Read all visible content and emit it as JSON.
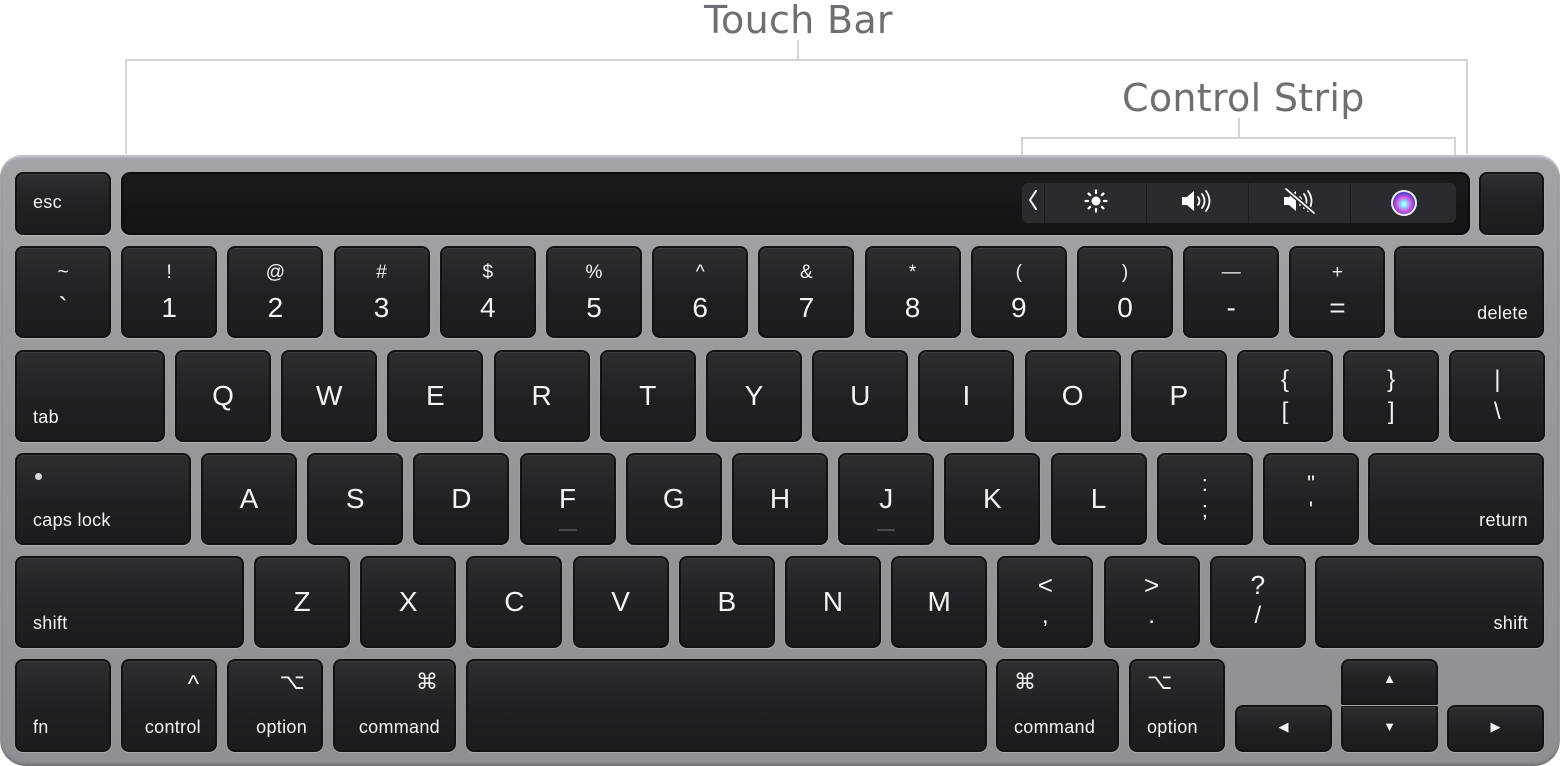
{
  "callouts": {
    "touch_bar": "Touch Bar",
    "control_strip": "Control Strip"
  },
  "touch_bar": {
    "esc": "esc",
    "control_strip": {
      "expand": "‹",
      "items": [
        {
          "name": "brightness",
          "icon": "sun-icon",
          "glyph": "☀"
        },
        {
          "name": "volume",
          "icon": "speaker-volume-icon",
          "glyph": "🔊"
        },
        {
          "name": "mute",
          "icon": "speaker-mute-icon",
          "glyph": "🔇"
        },
        {
          "name": "siri",
          "icon": "siri-icon",
          "glyph": ""
        }
      ]
    },
    "touch_id": ""
  },
  "rows": {
    "number": [
      {
        "top": "~",
        "bottom": "`"
      },
      {
        "top": "!",
        "bottom": "1"
      },
      {
        "top": "@",
        "bottom": "2"
      },
      {
        "top": "#",
        "bottom": "3"
      },
      {
        "top": "$",
        "bottom": "4"
      },
      {
        "top": "%",
        "bottom": "5"
      },
      {
        "top": "^",
        "bottom": "6"
      },
      {
        "top": "&",
        "bottom": "7"
      },
      {
        "top": "*",
        "bottom": "8"
      },
      {
        "top": "(",
        "bottom": "9"
      },
      {
        "top": ")",
        "bottom": "0"
      },
      {
        "top": "—",
        "bottom": "-"
      },
      {
        "top": "+",
        "bottom": "="
      }
    ],
    "delete": "delete",
    "tab": "tab",
    "qwerty": [
      "Q",
      "W",
      "E",
      "R",
      "T",
      "Y",
      "U",
      "I",
      "O",
      "P"
    ],
    "qwerty_punct": [
      {
        "top": "{",
        "bottom": "["
      },
      {
        "top": "}",
        "bottom": "]"
      },
      {
        "top": "|",
        "bottom": "\\"
      }
    ],
    "caps_lock": "caps lock",
    "home": [
      "A",
      "S",
      "D",
      "F",
      "G",
      "H",
      "J",
      "K",
      "L"
    ],
    "home_punct": [
      {
        "top": ":",
        "bottom": ";"
      },
      {
        "top": "\"",
        "bottom": "'"
      }
    ],
    "return": "return",
    "shift": "shift",
    "bottom_letters": [
      "Z",
      "X",
      "C",
      "V",
      "B",
      "N",
      "M"
    ],
    "bottom_punct": [
      {
        "top": "<",
        "bottom": ","
      },
      {
        "top": ">",
        "bottom": "."
      },
      {
        "top": "?",
        "bottom": "/"
      }
    ],
    "modifiers": {
      "fn": "fn",
      "control": "control",
      "control_symbol": "^",
      "option": "option",
      "option_symbol": "⌥",
      "command": "command",
      "command_symbol": "⌘"
    },
    "arrows": {
      "up": "▲",
      "down": "▼",
      "left": "◀",
      "right": "▶"
    }
  }
}
